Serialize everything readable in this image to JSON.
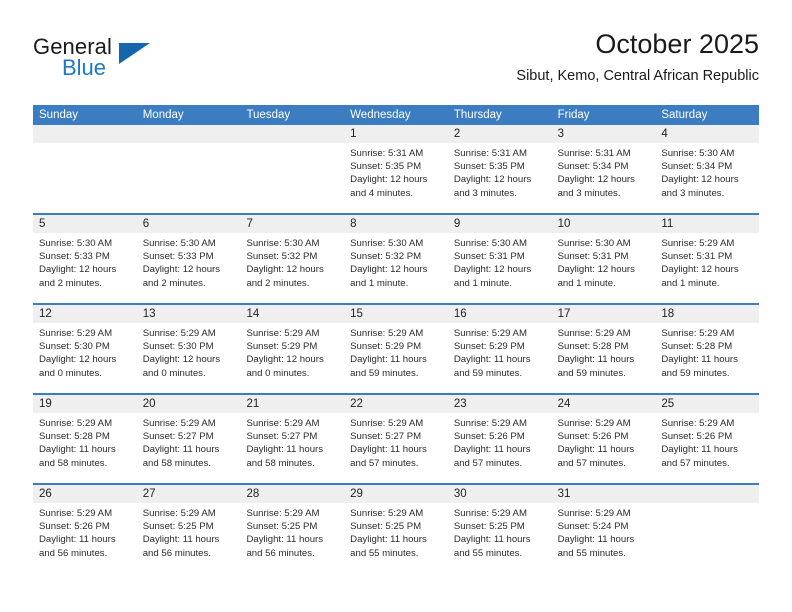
{
  "brand": {
    "word_one": "General",
    "word_two": "Blue",
    "logo_icon": "triangle-logo-icon",
    "accent_color": "#1466ad",
    "blue_text_color": "#2079c4"
  },
  "header": {
    "title": "October 2025",
    "location": "Sibut, Kemo, Central African Republic"
  },
  "calendar": {
    "header_bg": "#3b7dc0",
    "date_band_bg": "#efefef",
    "weekdays": [
      "Sunday",
      "Monday",
      "Tuesday",
      "Wednesday",
      "Thursday",
      "Friday",
      "Saturday"
    ],
    "weeks": [
      {
        "days": [
          {
            "date": "",
            "sunrise": "",
            "sunset": "",
            "daylight_line1": "",
            "daylight_line2": ""
          },
          {
            "date": "",
            "sunrise": "",
            "sunset": "",
            "daylight_line1": "",
            "daylight_line2": ""
          },
          {
            "date": "",
            "sunrise": "",
            "sunset": "",
            "daylight_line1": "",
            "daylight_line2": ""
          },
          {
            "date": "1",
            "sunrise": "Sunrise: 5:31 AM",
            "sunset": "Sunset: 5:35 PM",
            "daylight_line1": "Daylight: 12 hours",
            "daylight_line2": "and 4 minutes."
          },
          {
            "date": "2",
            "sunrise": "Sunrise: 5:31 AM",
            "sunset": "Sunset: 5:35 PM",
            "daylight_line1": "Daylight: 12 hours",
            "daylight_line2": "and 3 minutes."
          },
          {
            "date": "3",
            "sunrise": "Sunrise: 5:31 AM",
            "sunset": "Sunset: 5:34 PM",
            "daylight_line1": "Daylight: 12 hours",
            "daylight_line2": "and 3 minutes."
          },
          {
            "date": "4",
            "sunrise": "Sunrise: 5:30 AM",
            "sunset": "Sunset: 5:34 PM",
            "daylight_line1": "Daylight: 12 hours",
            "daylight_line2": "and 3 minutes."
          }
        ]
      },
      {
        "days": [
          {
            "date": "5",
            "sunrise": "Sunrise: 5:30 AM",
            "sunset": "Sunset: 5:33 PM",
            "daylight_line1": "Daylight: 12 hours",
            "daylight_line2": "and 2 minutes."
          },
          {
            "date": "6",
            "sunrise": "Sunrise: 5:30 AM",
            "sunset": "Sunset: 5:33 PM",
            "daylight_line1": "Daylight: 12 hours",
            "daylight_line2": "and 2 minutes."
          },
          {
            "date": "7",
            "sunrise": "Sunrise: 5:30 AM",
            "sunset": "Sunset: 5:32 PM",
            "daylight_line1": "Daylight: 12 hours",
            "daylight_line2": "and 2 minutes."
          },
          {
            "date": "8",
            "sunrise": "Sunrise: 5:30 AM",
            "sunset": "Sunset: 5:32 PM",
            "daylight_line1": "Daylight: 12 hours",
            "daylight_line2": "and 1 minute."
          },
          {
            "date": "9",
            "sunrise": "Sunrise: 5:30 AM",
            "sunset": "Sunset: 5:31 PM",
            "daylight_line1": "Daylight: 12 hours",
            "daylight_line2": "and 1 minute."
          },
          {
            "date": "10",
            "sunrise": "Sunrise: 5:30 AM",
            "sunset": "Sunset: 5:31 PM",
            "daylight_line1": "Daylight: 12 hours",
            "daylight_line2": "and 1 minute."
          },
          {
            "date": "11",
            "sunrise": "Sunrise: 5:29 AM",
            "sunset": "Sunset: 5:31 PM",
            "daylight_line1": "Daylight: 12 hours",
            "daylight_line2": "and 1 minute."
          }
        ]
      },
      {
        "days": [
          {
            "date": "12",
            "sunrise": "Sunrise: 5:29 AM",
            "sunset": "Sunset: 5:30 PM",
            "daylight_line1": "Daylight: 12 hours",
            "daylight_line2": "and 0 minutes."
          },
          {
            "date": "13",
            "sunrise": "Sunrise: 5:29 AM",
            "sunset": "Sunset: 5:30 PM",
            "daylight_line1": "Daylight: 12 hours",
            "daylight_line2": "and 0 minutes."
          },
          {
            "date": "14",
            "sunrise": "Sunrise: 5:29 AM",
            "sunset": "Sunset: 5:29 PM",
            "daylight_line1": "Daylight: 12 hours",
            "daylight_line2": "and 0 minutes."
          },
          {
            "date": "15",
            "sunrise": "Sunrise: 5:29 AM",
            "sunset": "Sunset: 5:29 PM",
            "daylight_line1": "Daylight: 11 hours",
            "daylight_line2": "and 59 minutes."
          },
          {
            "date": "16",
            "sunrise": "Sunrise: 5:29 AM",
            "sunset": "Sunset: 5:29 PM",
            "daylight_line1": "Daylight: 11 hours",
            "daylight_line2": "and 59 minutes."
          },
          {
            "date": "17",
            "sunrise": "Sunrise: 5:29 AM",
            "sunset": "Sunset: 5:28 PM",
            "daylight_line1": "Daylight: 11 hours",
            "daylight_line2": "and 59 minutes."
          },
          {
            "date": "18",
            "sunrise": "Sunrise: 5:29 AM",
            "sunset": "Sunset: 5:28 PM",
            "daylight_line1": "Daylight: 11 hours",
            "daylight_line2": "and 59 minutes."
          }
        ]
      },
      {
        "days": [
          {
            "date": "19",
            "sunrise": "Sunrise: 5:29 AM",
            "sunset": "Sunset: 5:28 PM",
            "daylight_line1": "Daylight: 11 hours",
            "daylight_line2": "and 58 minutes."
          },
          {
            "date": "20",
            "sunrise": "Sunrise: 5:29 AM",
            "sunset": "Sunset: 5:27 PM",
            "daylight_line1": "Daylight: 11 hours",
            "daylight_line2": "and 58 minutes."
          },
          {
            "date": "21",
            "sunrise": "Sunrise: 5:29 AM",
            "sunset": "Sunset: 5:27 PM",
            "daylight_line1": "Daylight: 11 hours",
            "daylight_line2": "and 58 minutes."
          },
          {
            "date": "22",
            "sunrise": "Sunrise: 5:29 AM",
            "sunset": "Sunset: 5:27 PM",
            "daylight_line1": "Daylight: 11 hours",
            "daylight_line2": "and 57 minutes."
          },
          {
            "date": "23",
            "sunrise": "Sunrise: 5:29 AM",
            "sunset": "Sunset: 5:26 PM",
            "daylight_line1": "Daylight: 11 hours",
            "daylight_line2": "and 57 minutes."
          },
          {
            "date": "24",
            "sunrise": "Sunrise: 5:29 AM",
            "sunset": "Sunset: 5:26 PM",
            "daylight_line1": "Daylight: 11 hours",
            "daylight_line2": "and 57 minutes."
          },
          {
            "date": "25",
            "sunrise": "Sunrise: 5:29 AM",
            "sunset": "Sunset: 5:26 PM",
            "daylight_line1": "Daylight: 11 hours",
            "daylight_line2": "and 57 minutes."
          }
        ]
      },
      {
        "days": [
          {
            "date": "26",
            "sunrise": "Sunrise: 5:29 AM",
            "sunset": "Sunset: 5:26 PM",
            "daylight_line1": "Daylight: 11 hours",
            "daylight_line2": "and 56 minutes."
          },
          {
            "date": "27",
            "sunrise": "Sunrise: 5:29 AM",
            "sunset": "Sunset: 5:25 PM",
            "daylight_line1": "Daylight: 11 hours",
            "daylight_line2": "and 56 minutes."
          },
          {
            "date": "28",
            "sunrise": "Sunrise: 5:29 AM",
            "sunset": "Sunset: 5:25 PM",
            "daylight_line1": "Daylight: 11 hours",
            "daylight_line2": "and 56 minutes."
          },
          {
            "date": "29",
            "sunrise": "Sunrise: 5:29 AM",
            "sunset": "Sunset: 5:25 PM",
            "daylight_line1": "Daylight: 11 hours",
            "daylight_line2": "and 55 minutes."
          },
          {
            "date": "30",
            "sunrise": "Sunrise: 5:29 AM",
            "sunset": "Sunset: 5:25 PM",
            "daylight_line1": "Daylight: 11 hours",
            "daylight_line2": "and 55 minutes."
          },
          {
            "date": "31",
            "sunrise": "Sunrise: 5:29 AM",
            "sunset": "Sunset: 5:24 PM",
            "daylight_line1": "Daylight: 11 hours",
            "daylight_line2": "and 55 minutes."
          },
          {
            "date": "",
            "sunrise": "",
            "sunset": "",
            "daylight_line1": "",
            "daylight_line2": ""
          }
        ]
      }
    ]
  }
}
